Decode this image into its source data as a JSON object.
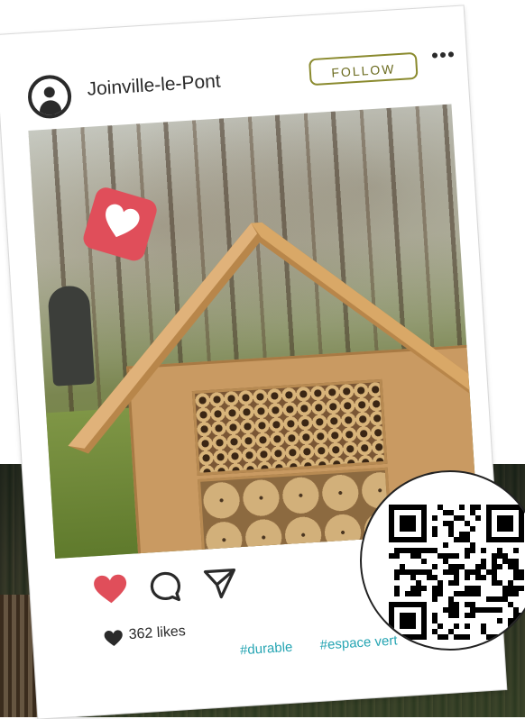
{
  "post": {
    "username": "Joinville-le-Pont",
    "follow_label": "FOLLOW",
    "likes_text": "362 likes",
    "hashtags": [
      "#durable",
      "#espace vert"
    ]
  },
  "icons": {
    "avatar": "user-avatar-icon",
    "more": "more-dots-icon",
    "like_bubble": "heart-notification-icon",
    "like": "heart-icon",
    "comment": "comment-icon",
    "share": "send-icon",
    "likes": "small-heart-icon",
    "qr": "qr-code"
  },
  "colors": {
    "follow_border": "#8a8a2e",
    "like_red": "#e04e5a",
    "hashtag": "#26a5b3",
    "text": "#2a2a2a"
  }
}
